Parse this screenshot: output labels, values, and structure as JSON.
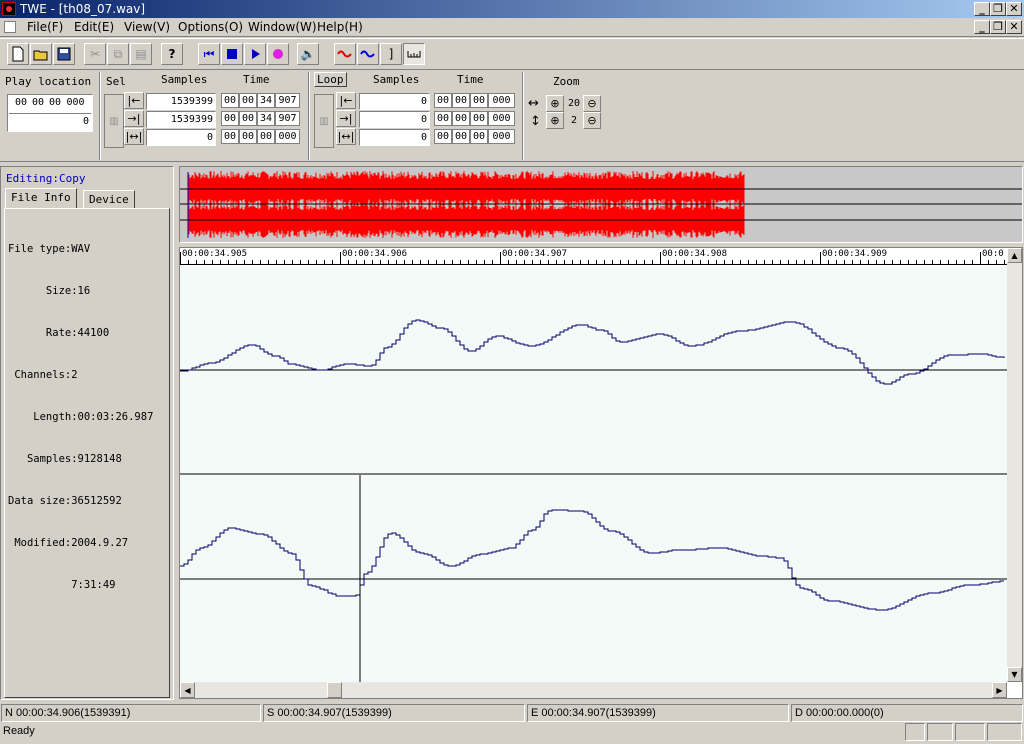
{
  "window": {
    "title": "TWE - [th08_07.wav]"
  },
  "menu": {
    "items": [
      "File(F)",
      "Edit(E)",
      "View(V)",
      "Options(O)",
      "Window(W)",
      "Help(H)"
    ]
  },
  "controls": {
    "play_location": {
      "label": "Play location",
      "time": [
        "00",
        "00",
        "00",
        "000"
      ],
      "samples": "0"
    },
    "sel": {
      "label": "Sel",
      "samples_header": "Samples",
      "time_header": "Time",
      "rows": [
        {
          "samples": "1539399",
          "time": [
            "00",
            "00",
            "34",
            "907"
          ]
        },
        {
          "samples": "1539399",
          "time": [
            "00",
            "00",
            "34",
            "907"
          ]
        },
        {
          "samples": "0",
          "time": [
            "00",
            "00",
            "00",
            "000"
          ]
        }
      ]
    },
    "loop": {
      "label": "Loop",
      "samples_header": "Samples",
      "time_header": "Time",
      "rows": [
        {
          "samples": "0",
          "time": [
            "00",
            "00",
            "00",
            "000"
          ]
        },
        {
          "samples": "0",
          "time": [
            "00",
            "00",
            "00",
            "000"
          ]
        },
        {
          "samples": "0",
          "time": [
            "00",
            "00",
            "00",
            "000"
          ]
        }
      ]
    },
    "zoom": {
      "label": "Zoom",
      "horizontal": "20",
      "vertical": "2"
    }
  },
  "left_panel": {
    "editing": "Editing:Copy",
    "tabs": [
      "File Info",
      "Device"
    ],
    "info_lines": [
      "File type:WAV",
      "      Size:16",
      "      Rate:44100",
      " Channels:2",
      "    Length:00:03:26.987",
      "   Samples:9128148",
      "Data size:36512592",
      " Modified:2004.9.27",
      "          7:31:49"
    ]
  },
  "ruler": {
    "labels": [
      "00:00:34.905",
      "00:00:34.906",
      "00:00:34.907",
      "00:00:34.908",
      "00:00:34.909",
      "00:0"
    ]
  },
  "status": {
    "n": "N 00:00:34.906(1539391)",
    "s": "S 00:00:34.907(1539399)",
    "e": "E 00:00:34.907(1539399)",
    "d": "D 00:00:00.000(0)",
    "ready": "Ready"
  },
  "colors": {
    "overview_wave": "#ff0000",
    "wave_line": "#000066",
    "wave_bg": "#f4faf8"
  }
}
